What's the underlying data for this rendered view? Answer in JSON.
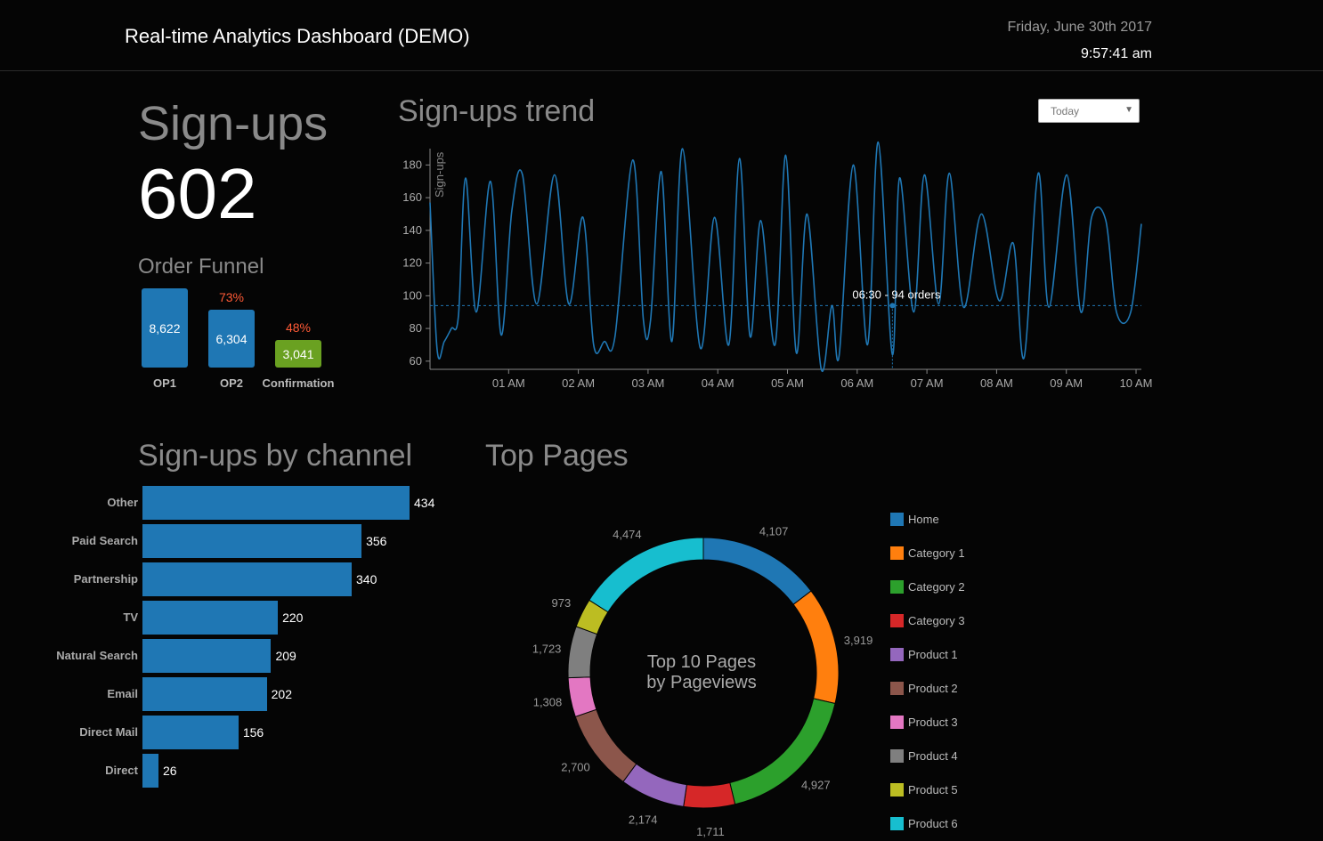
{
  "header": {
    "title": "Real-time Analytics Dashboard (DEMO)",
    "date": "Friday, June 30th 2017",
    "time": "9:57:41 am"
  },
  "signups": {
    "title": "Sign-ups",
    "count": "602"
  },
  "funnel": {
    "title": "Order Funnel",
    "steps": [
      {
        "label": "OP1",
        "value": "8,622",
        "pct": ""
      },
      {
        "label": "OP2",
        "value": "6,304",
        "pct": "73%"
      },
      {
        "label": "Confirmation",
        "value": "3,041",
        "pct": "48%"
      }
    ]
  },
  "trend": {
    "title": "Sign-ups trend",
    "dropdown_value": "Today",
    "ylabel": "Sign-ups",
    "tooltip": "06:30 - 94 orders"
  },
  "channel": {
    "title": "Sign-ups by channel"
  },
  "top_pages": {
    "title": "Top Pages",
    "center_line1": "Top 10 Pages",
    "center_line2": "by Pageviews"
  },
  "colors": {
    "blue": "#1f77b4",
    "green_bar": "#6aa121",
    "funnel_pct": "#ff5a36"
  },
  "chart_data": [
    {
      "type": "bar",
      "title": "Order Funnel",
      "categories": [
        "OP1",
        "OP2",
        "Confirmation"
      ],
      "values": [
        8622,
        6304,
        3041
      ],
      "annotations": [
        "",
        "73%",
        "48%"
      ]
    },
    {
      "type": "line",
      "title": "Sign-ups trend",
      "ylabel": "Sign-ups",
      "ylim": [
        55,
        190
      ],
      "yticks": [
        60,
        80,
        100,
        120,
        140,
        160,
        180
      ],
      "xticks": [
        "01 AM",
        "02 AM",
        "03 AM",
        "04 AM",
        "05 AM",
        "06 AM",
        "07 AM",
        "08 AM",
        "09 AM",
        "10 AM"
      ],
      "reference_line": 94,
      "x": [
        0.0,
        0.1,
        0.2,
        0.3,
        0.4,
        0.5,
        0.65,
        0.85,
        1.0,
        1.15,
        1.3,
        1.5,
        1.75,
        1.95,
        2.15,
        2.3,
        2.45,
        2.6,
        2.85,
        3.0,
        3.1,
        3.25,
        3.4,
        3.55,
        3.8,
        4.0,
        4.2,
        4.35,
        4.5,
        4.65,
        4.85,
        5.0,
        5.15,
        5.3,
        5.5,
        5.65,
        5.75,
        5.95,
        6.15,
        6.3,
        6.5,
        6.6,
        6.8,
        6.95,
        7.15,
        7.3,
        7.5,
        7.75,
        8.0,
        8.2,
        8.35,
        8.55,
        8.7,
        8.95,
        9.15,
        9.3,
        9.5,
        9.65,
        9.85,
        10.0
      ],
      "values": [
        157,
        67,
        72,
        80,
        88,
        172,
        90,
        170,
        76,
        152,
        174,
        95,
        174,
        95,
        148,
        70,
        72,
        75,
        183,
        85,
        85,
        176,
        72,
        190,
        68,
        148,
        70,
        184,
        75,
        146,
        70,
        186,
        65,
        150,
        55,
        94,
        63,
        180,
        70,
        194,
        64,
        172,
        90,
        174,
        95,
        175,
        93,
        150,
        97,
        132,
        62,
        175,
        93,
        174,
        90,
        148,
        146,
        90,
        90,
        144
      ]
    },
    {
      "type": "bar",
      "title": "Sign-ups by channel",
      "categories": [
        "Other",
        "Paid Search",
        "Partnership",
        "TV",
        "Natural Search",
        "Email",
        "Direct Mail",
        "Direct"
      ],
      "values": [
        434,
        356,
        340,
        220,
        209,
        202,
        156,
        26
      ]
    },
    {
      "type": "pie",
      "title": "Top 10 Pages by Pageviews",
      "categories": [
        "Home",
        "Category 1",
        "Category 2",
        "Category 3",
        "Product 1",
        "Product 2",
        "Product 3",
        "Product 4",
        "Product 5",
        "Product 6"
      ],
      "values": [
        4107,
        3919,
        4927,
        1711,
        2174,
        2700,
        1308,
        1723,
        973,
        4474
      ],
      "labels": [
        "4,107",
        "3,919",
        "4,927",
        "1,711",
        "2,174",
        "2,700",
        "1,308",
        "1,723",
        "973",
        "4,474"
      ],
      "colors": [
        "#1f77b4",
        "#ff7f0e",
        "#2ca02c",
        "#d62728",
        "#9467bd",
        "#8c564b",
        "#e377c2",
        "#7f7f7f",
        "#bcbd22",
        "#17becf"
      ]
    }
  ]
}
